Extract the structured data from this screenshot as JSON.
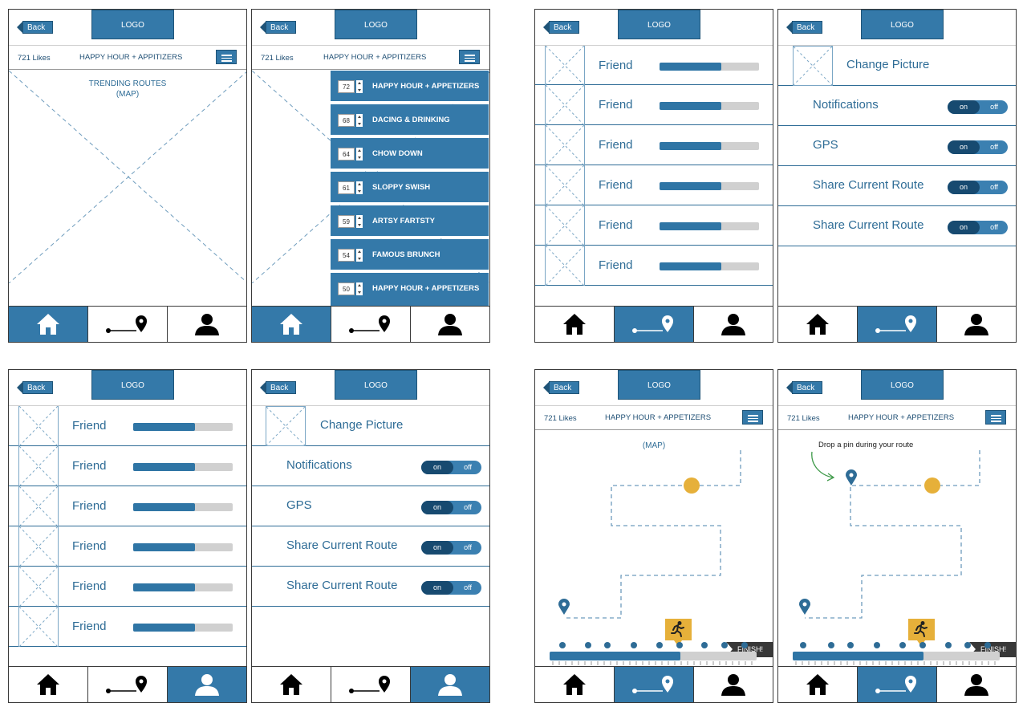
{
  "common": {
    "back_label": "Back",
    "logo_label": "LOGO",
    "likes": "721 Likes",
    "route_title_short": "HAPPY HOUR + APPITIZERS",
    "route_title": "HAPPY HOUR + APPETIZERS"
  },
  "nav": [
    "home-icon",
    "route-icon",
    "profile-icon"
  ],
  "colors": {
    "primary": "#3479a9",
    "dark": "#174a70",
    "accent": "#e6b03a",
    "border": "#3a3a3a"
  },
  "trending": {
    "line1": "TRENDING ROUTES",
    "line2": "(MAP)"
  },
  "categories": [
    {
      "count": "72",
      "label": "HAPPY HOUR + APPETIZERS"
    },
    {
      "count": "68",
      "label": "DACING & DRINKING"
    },
    {
      "count": "64",
      "label": "CHOW DOWN"
    },
    {
      "count": "61",
      "label": "SLOPPY SWISH"
    },
    {
      "count": "59",
      "label": "ARTSY FARTSTY"
    },
    {
      "count": "54",
      "label": "FAMOUS BRUNCH"
    },
    {
      "count": "50",
      "label": "HAPPY HOUR + APPETIZERS"
    }
  ],
  "friends": {
    "label": "Friend",
    "progress": 0.62
  },
  "settings": {
    "change_picture": "Change Picture",
    "rows": [
      "Notifications",
      "GPS",
      "Share Current Route",
      "Share Current Route"
    ],
    "toggle_on": "on",
    "toggle_off": "off"
  },
  "route_map": {
    "label": "(MAP)",
    "finish": "FINISH!",
    "hint": "Drop a pin during your route",
    "progress": 0.63
  }
}
